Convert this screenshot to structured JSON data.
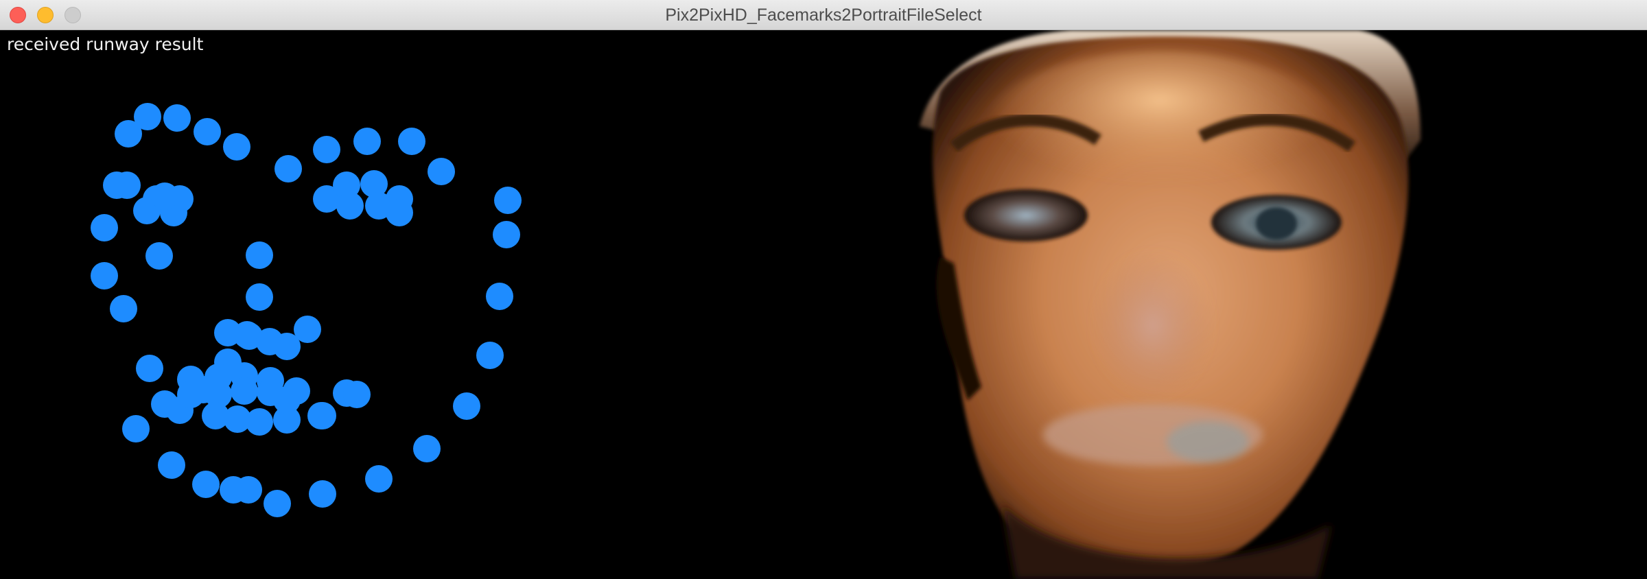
{
  "window": {
    "title": "Pix2PixHD_Facemarks2PortraitFileSelect",
    "controls": [
      "close-button",
      "minimize-button",
      "zoom-button"
    ]
  },
  "canvas": {
    "status": "received runway result",
    "landmark_color": "#1e8cff",
    "portrait_description_icon": "generated-portrait-image"
  }
}
